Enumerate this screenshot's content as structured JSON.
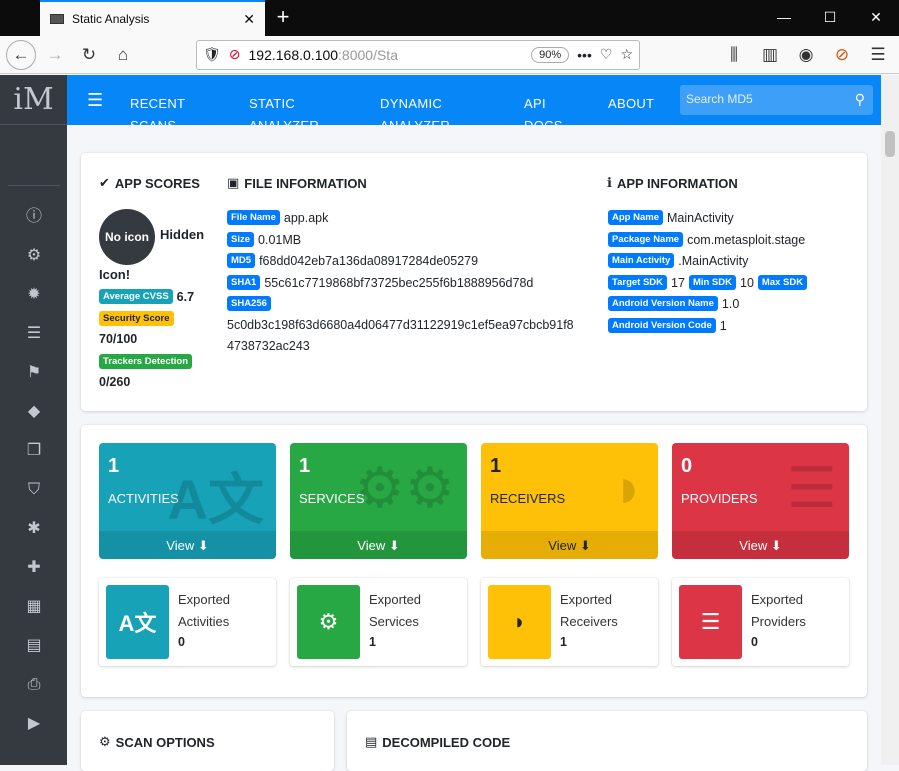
{
  "browser": {
    "tab_title": "Static Analysis",
    "url_host": "192.168.0.100",
    "url_rest": ":8000/Sta",
    "zoom": "90%"
  },
  "nav": {
    "links": [
      "RECENT SCANS",
      "STATIC ANALYZER",
      "DYNAMIC ANALYZER",
      "API DOCS",
      "ABOUT"
    ],
    "search_placeholder": "Search MD5"
  },
  "sidebar": {
    "logo": "iM",
    "icons": [
      "info-icon",
      "gear-icon",
      "cog-icon",
      "list-icon",
      "flag-icon",
      "android-icon",
      "copy-icon",
      "shield-icon",
      "bug-icon",
      "plus-icon",
      "grid-icon",
      "pdf-icon",
      "print-icon",
      "play-icon"
    ]
  },
  "app_scores": {
    "title": "APP SCORES",
    "no_icon": "No icon",
    "hidden_text": "Hidden",
    "icon_text": "Icon!",
    "cvss_label": "Average CVSS",
    "cvss_value": "6.7",
    "security_label": "Security Score",
    "security_value": "70/100",
    "trackers_label": "Trackers Detection",
    "trackers_value": "0/260"
  },
  "file_info": {
    "title": "FILE INFORMATION",
    "file_name_label": "File Name",
    "file_name": "app.apk",
    "size_label": "Size",
    "size": "0.01MB",
    "md5_label": "MD5",
    "md5": "f68dd042eb7a136da08917284de05279",
    "sha1_label": "SHA1",
    "sha1": "55c61c7719868bf73725bec255f6b1888956d78d",
    "sha256_label": "SHA256",
    "sha256_a": "5c0db3c198f63d6680a4d06477d31122919c1ef5ea97cbcb91f8",
    "sha256_b": "4738732ac243"
  },
  "app_info": {
    "title": "APP INFORMATION",
    "app_name_label": "App Name",
    "app_name": "MainActivity",
    "package_label": "Package Name",
    "package": "com.metasploit.stage",
    "main_label": "Main Activity",
    "main_activity": ".MainActivity",
    "target_label": "Target SDK",
    "target": "17",
    "min_label": "Min SDK",
    "min": "10",
    "max_label": "Max SDK",
    "version_name_label": "Android Version Name",
    "version_name": "1.0",
    "version_code_label": "Android Version Code",
    "version_code": "1"
  },
  "stats": [
    {
      "count": "1",
      "label": "ACTIVITIES",
      "view": "View",
      "color": "#17a2b8"
    },
    {
      "count": "1",
      "label": "SERVICES",
      "view": "View",
      "color": "#28a745"
    },
    {
      "count": "1",
      "label": "RECEIVERS",
      "view": "View",
      "color": "#ffc107"
    },
    {
      "count": "0",
      "label": "PROVIDERS",
      "view": "View",
      "color": "#dc3545"
    }
  ],
  "exported": [
    {
      "l1": "Exported",
      "l2": "Activities",
      "value": "0"
    },
    {
      "l1": "Exported",
      "l2": "Services",
      "value": "1"
    },
    {
      "l1": "Exported",
      "l2": "Receivers",
      "value": "1"
    },
    {
      "l1": "Exported",
      "l2": "Providers",
      "value": "0"
    }
  ],
  "bottom": {
    "scan_options": "SCAN OPTIONS",
    "decompiled": "DECOMPILED CODE"
  }
}
